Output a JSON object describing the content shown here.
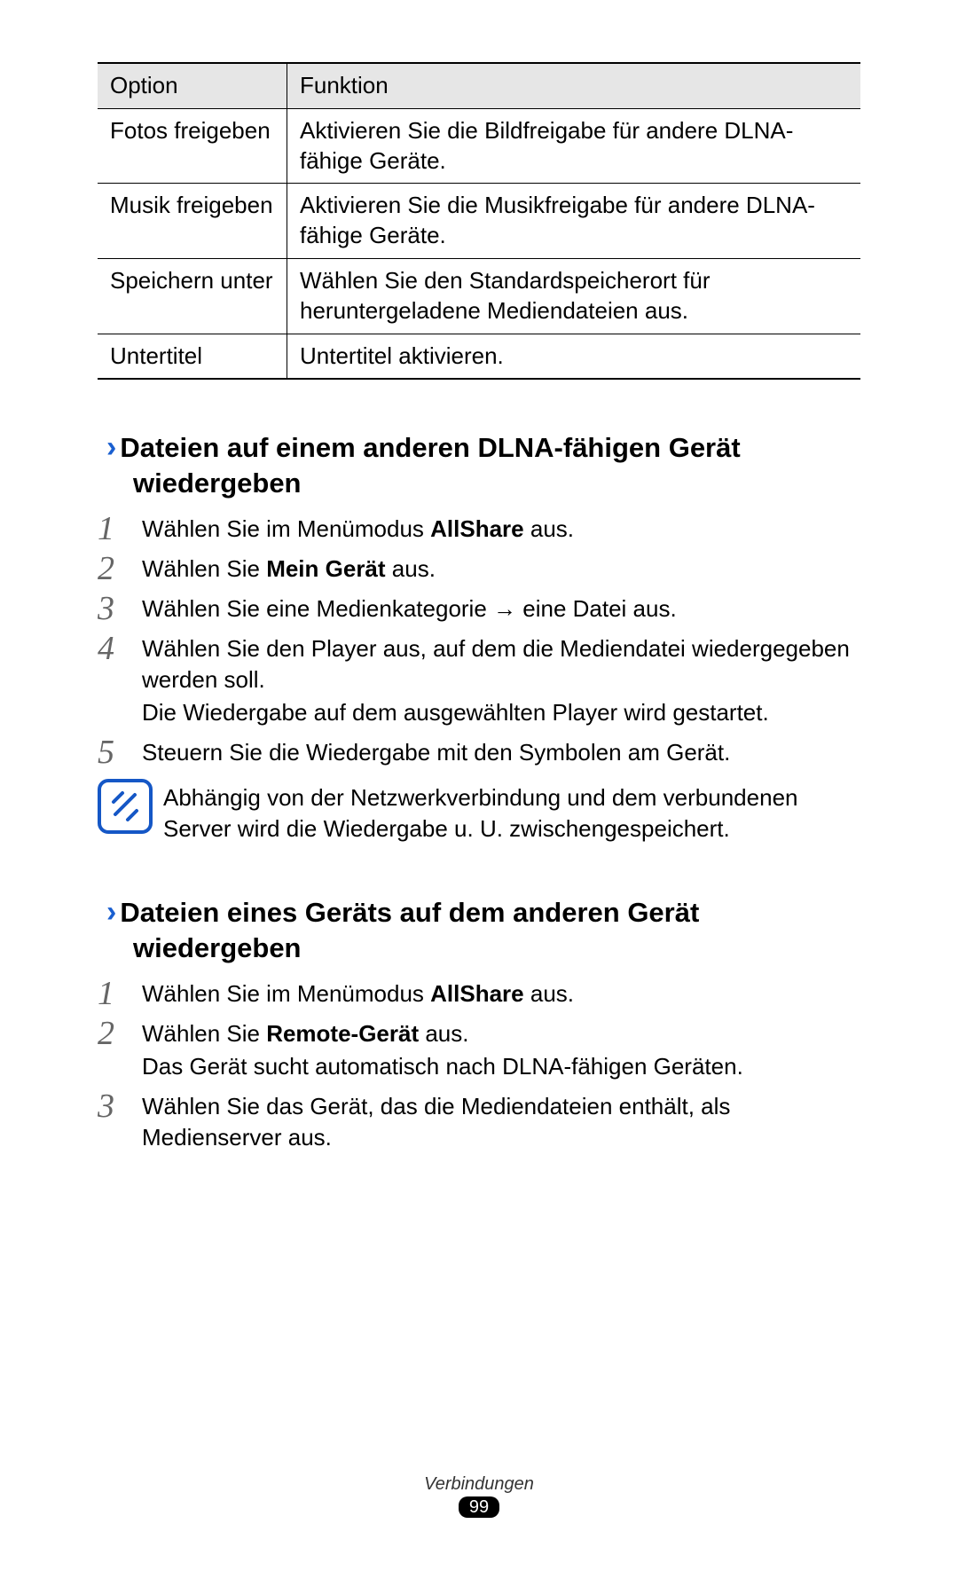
{
  "table": {
    "header": {
      "option": "Option",
      "function": "Funktion"
    },
    "rows": [
      {
        "option": "Fotos freigeben",
        "function": "Aktivieren Sie die Bildfreigabe für andere DLNA-fähige Geräte."
      },
      {
        "option": "Musik freigeben",
        "function": "Aktivieren Sie die Musikfreigabe für andere DLNA-fähige Geräte."
      },
      {
        "option": "Speichern unter",
        "function": "Wählen Sie den Standardspeicherort für heruntergeladene Mediendateien aus."
      },
      {
        "option": "Untertitel",
        "function": "Untertitel aktivieren."
      }
    ]
  },
  "chevron": "›",
  "section1": {
    "title": "Dateien auf einem anderen DLNA-fähigen Gerät wiedergeben",
    "steps": {
      "n1": "1",
      "s1a": "Wählen Sie im Menümodus ",
      "s1b": "AllShare",
      "s1c": " aus.",
      "n2": "2",
      "s2a": "Wählen Sie ",
      "s2b": "Mein Gerät",
      "s2c": " aus.",
      "n3": "3",
      "s3": "Wählen Sie eine Medienkategorie → eine Datei aus.",
      "n4": "4",
      "s4a": "Wählen Sie den Player aus, auf dem die Mediendatei wiedergegeben werden soll.",
      "s4b": "Die Wiedergabe auf dem ausgewählten Player wird gestartet.",
      "n5": "5",
      "s5": "Steuern Sie die Wiedergabe mit den Symbolen am Gerät."
    },
    "note": "Abhängig von der Netzwerkverbindung und dem verbundenen Server wird die Wiedergabe u. U. zwischengespeichert."
  },
  "section2": {
    "title": "Dateien eines Geräts auf dem anderen Gerät wiedergeben",
    "steps": {
      "n1": "1",
      "s1a": "Wählen Sie im Menümodus ",
      "s1b": "AllShare",
      "s1c": " aus.",
      "n2": "2",
      "s2a": "Wählen Sie ",
      "s2b": "Remote-Gerät",
      "s2c": " aus.",
      "s2d": "Das Gerät sucht automatisch nach DLNA-fähigen Geräten.",
      "n3": "3",
      "s3": "Wählen Sie das Gerät, das die Mediendateien enthält, als Medienserver aus."
    }
  },
  "footer": {
    "section": "Verbindungen",
    "page": "99"
  }
}
